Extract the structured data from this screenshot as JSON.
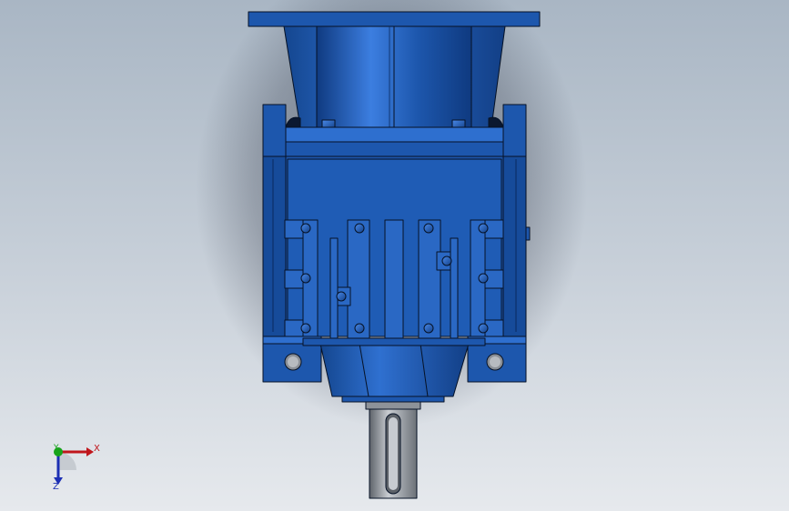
{
  "viewport": {
    "background_top": "#a9b6c4",
    "background_bottom": "#e6e9ed"
  },
  "model": {
    "name": "gear-reducer",
    "body_color": "#1d57ad",
    "body_dark": "#0f3a80",
    "body_light": "#3c7ee0",
    "shaft_color": "#9a9fa6",
    "edge_color": "#061226"
  },
  "triad": {
    "x_label": "X",
    "y_label": "Y",
    "z_label": "Z",
    "x_color": "#c0161c",
    "y_color": "#17a31a",
    "z_color": "#1c2fb4"
  }
}
